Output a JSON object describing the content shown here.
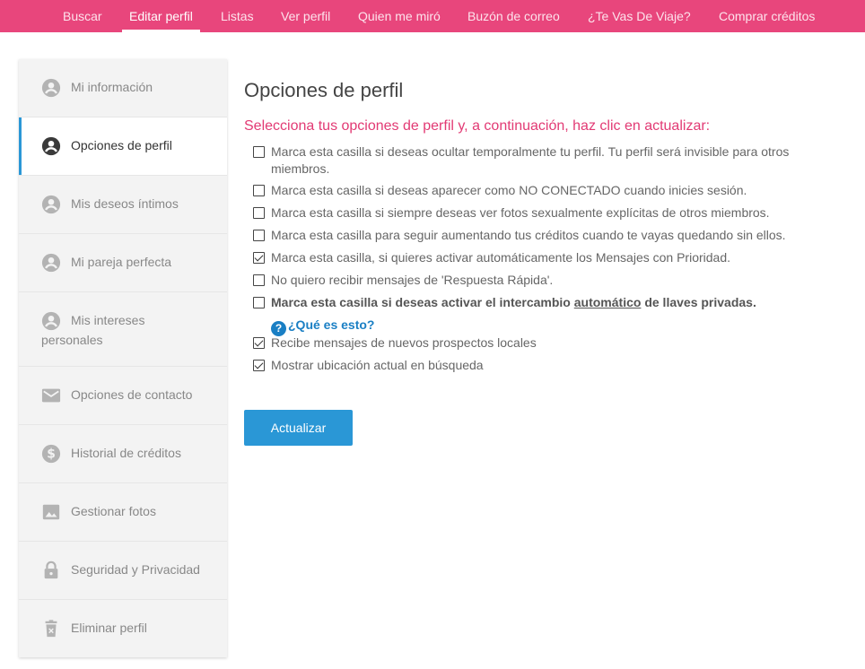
{
  "nav": {
    "items": [
      {
        "label": "Buscar",
        "active": false
      },
      {
        "label": "Editar perfil",
        "active": true
      },
      {
        "label": "Listas",
        "active": false
      },
      {
        "label": "Ver perfil",
        "active": false
      },
      {
        "label": "Quien me miró",
        "active": false
      },
      {
        "label": "Buzón de correo",
        "active": false
      },
      {
        "label": "¿Te Vas De Viaje?",
        "active": false
      },
      {
        "label": "Comprar créditos",
        "active": false
      }
    ]
  },
  "sidebar": {
    "items": [
      {
        "label": "Mi información",
        "icon": "account-circle-icon"
      },
      {
        "label": "Opciones de perfil",
        "icon": "account-circle-icon",
        "active": true
      },
      {
        "label": "Mis deseos íntimos",
        "icon": "account-circle-icon"
      },
      {
        "label": "Mi pareja perfecta",
        "icon": "account-circle-icon"
      },
      {
        "label": "Mis intereses personales",
        "icon": "account-circle-icon"
      },
      {
        "label": "Opciones de contacto",
        "icon": "envelope-icon"
      },
      {
        "label": "Historial de créditos",
        "icon": "dollar-icon"
      },
      {
        "label": "Gestionar fotos",
        "icon": "image-icon"
      },
      {
        "label": "Seguridad y Privacidad",
        "icon": "lock-icon"
      },
      {
        "label": "Eliminar perfil",
        "icon": "trash-icon"
      }
    ]
  },
  "main": {
    "title": "Opciones de perfil",
    "instructions": "Selecciona tus opciones de perfil y, a continuación, haz clic en actualizar:",
    "options": [
      {
        "text": "Marca esta casilla si deseas ocultar temporalmente tu perfil. Tu perfil será invisible para otros miembros.",
        "checked": false
      },
      {
        "text": "Marca esta casilla si deseas aparecer como NO CONECTADO cuando inicies sesión.",
        "checked": false
      },
      {
        "text": "Marca esta casilla si siempre deseas ver fotos sexualmente explícitas de otros miembros.",
        "checked": false
      },
      {
        "text": "Marca esta casilla para seguir aumentando tus créditos cuando te vayas quedando sin ellos.",
        "checked": false
      },
      {
        "text": "Marca esta casilla, si quieres activar automáticamente los Mensajes con Prioridad.",
        "checked": true
      },
      {
        "text": "No quiero recibir mensajes de 'Respuesta Rápida'.",
        "checked": false
      },
      {
        "text_before": "Marca esta casilla si deseas activar el intercambio ",
        "text_underlined": "automático",
        "text_after": " de llaves privadas.",
        "help_label": "¿Qué es esto?",
        "checked": false
      },
      {
        "text": "Recibe mensajes de nuevos prospectos locales",
        "checked": true
      },
      {
        "text": "Mostrar ubicación actual en búsqueda",
        "checked": true
      }
    ],
    "update_label": "Actualizar"
  },
  "colors": {
    "nav_bg": "#e8467c",
    "accent_pink": "#e23a74",
    "button_blue": "#2a97d6",
    "link_blue": "#1a7fc4",
    "sidebar_bg": "#f3f3f3"
  }
}
